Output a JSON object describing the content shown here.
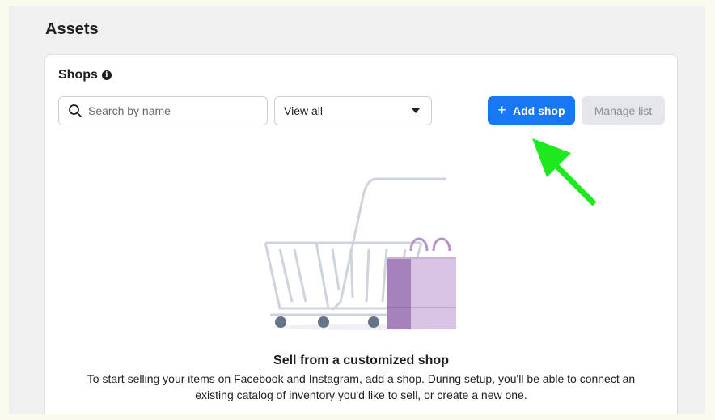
{
  "page": {
    "title": "Assets"
  },
  "shops": {
    "title": "Shops",
    "info_icon": "info-icon",
    "search": {
      "placeholder": "Search by name",
      "value": ""
    },
    "filter": {
      "selected": "View all"
    },
    "add_button": {
      "label": "Add shop",
      "icon": "plus-icon"
    },
    "manage_button": {
      "label": "Manage list"
    },
    "empty_state": {
      "title": "Sell from a customized shop",
      "description": "To start selling your items on Facebook and Instagram, add a shop. During setup, you'll be able to connect an existing catalog of inventory you'd like to sell, or create a new one.",
      "illustration": "shopping-cart-with-bag"
    }
  },
  "colors": {
    "primary": "#1877f2",
    "secondary_bg": "#e4e6eb",
    "annotation_arrow": "#1ee81e",
    "bag_purple": "#c9b3d6"
  }
}
